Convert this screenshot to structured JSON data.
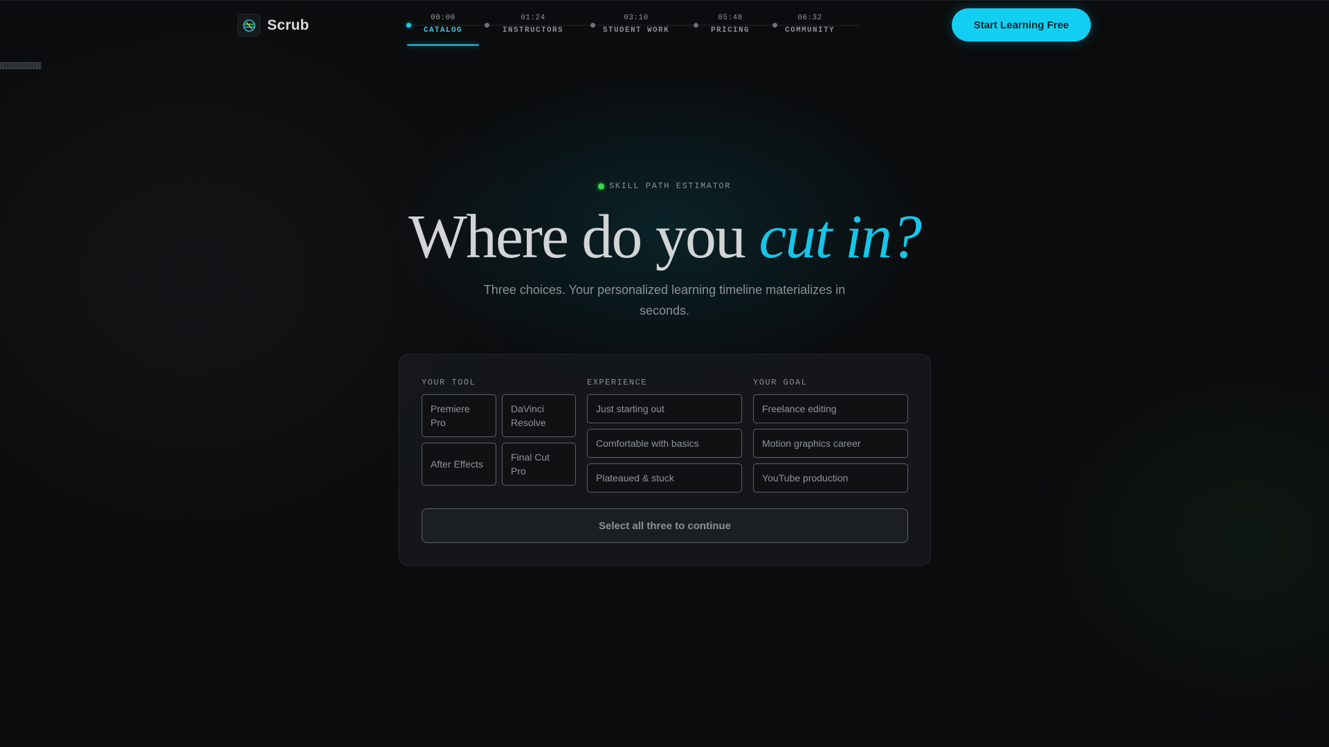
{
  "brand": {
    "name": "Scrub",
    "logo_icon": "scrub-logo-icon"
  },
  "nav": {
    "items": [
      {
        "time": "00:00",
        "label": "CATALOG",
        "active": true
      },
      {
        "time": "01:24",
        "label": "INSTRUCTORS",
        "active": false
      },
      {
        "time": "03:10",
        "label": "STUDENT WORK",
        "active": false
      },
      {
        "time": "05:48",
        "label": "PRICING",
        "active": false
      },
      {
        "time": "06:32",
        "label": "COMMUNITY",
        "active": false
      }
    ]
  },
  "header": {
    "cta_label": "Start Learning Free"
  },
  "hero": {
    "eyebrow": "SKILL PATH ESTIMATOR",
    "headline_plain": "Where do you ",
    "headline_accent": "cut in?",
    "subtitle": "Three choices. Your personalized learning timeline materializes in seconds."
  },
  "estimator": {
    "tool": {
      "title": "YOUR TOOL",
      "options": [
        "Premiere Pro",
        "DaVinci Resolve",
        "After Effects",
        "Final Cut Pro"
      ]
    },
    "experience": {
      "title": "EXPERIENCE",
      "options": [
        "Just starting out",
        "Comfortable with basics",
        "Plateaued & stuck"
      ]
    },
    "goal": {
      "title": "YOUR GOAL",
      "options": [
        "Freelance editing",
        "Motion graphics career",
        "YouTube production"
      ]
    },
    "continue_label": "Select all three to continue"
  },
  "colors": {
    "accent": "#12cff2",
    "live_dot": "#34d84a",
    "background": "#0b0c0d"
  }
}
